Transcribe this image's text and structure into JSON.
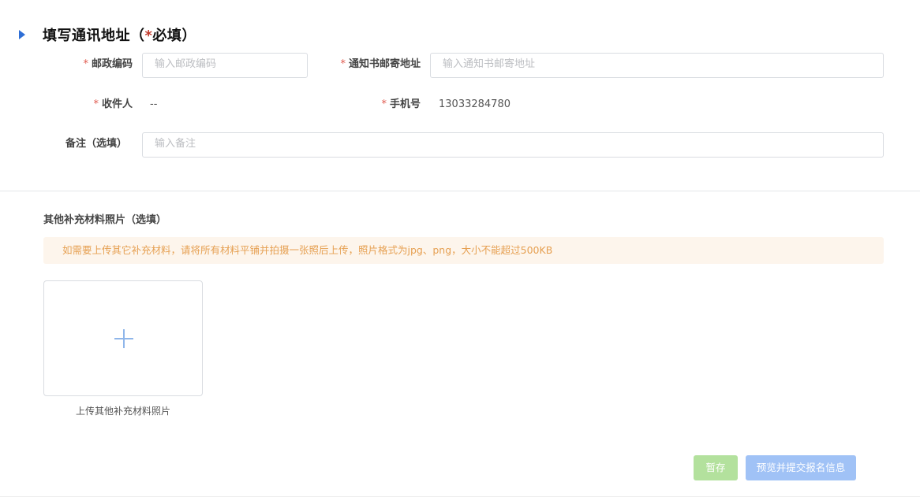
{
  "section": {
    "title_prefix": "填写通讯地址（",
    "title_star": "*",
    "title_suffix": "必填）"
  },
  "form": {
    "postal_code": {
      "star": "*",
      "label": "邮政编码",
      "placeholder": "输入邮政编码"
    },
    "mail_address": {
      "star": "*",
      "label": "通知书邮寄地址",
      "placeholder": "输入通知书邮寄地址"
    },
    "recipient": {
      "star": "*",
      "label": "收件人",
      "value": "--"
    },
    "phone": {
      "star": "*",
      "label": "手机号",
      "value": "13033284780"
    },
    "remark": {
      "label": "备注（选填）",
      "placeholder": "输入备注"
    }
  },
  "materials": {
    "title": "其他补充材料照片（选填）",
    "notice": "如需要上传其它补充材料，请将所有材料平铺并拍摄一张照后上传，照片格式为jpg、png，大小不能超过500KB",
    "upload_caption": "上传其他补充材料照片"
  },
  "actions": {
    "save_label": "暂存",
    "submit_label": "预览并提交报名信息"
  },
  "colors": {
    "accent": "#2f6fd6",
    "required": "#e05a4f",
    "notice_text": "#e6a052",
    "notice_bg": "#fdf5ec",
    "save_button": "#b3e19d",
    "submit_button": "#a0c2f6"
  },
  "icons": {
    "section_marker": "chevron-right-icon",
    "upload": "plus-icon"
  }
}
